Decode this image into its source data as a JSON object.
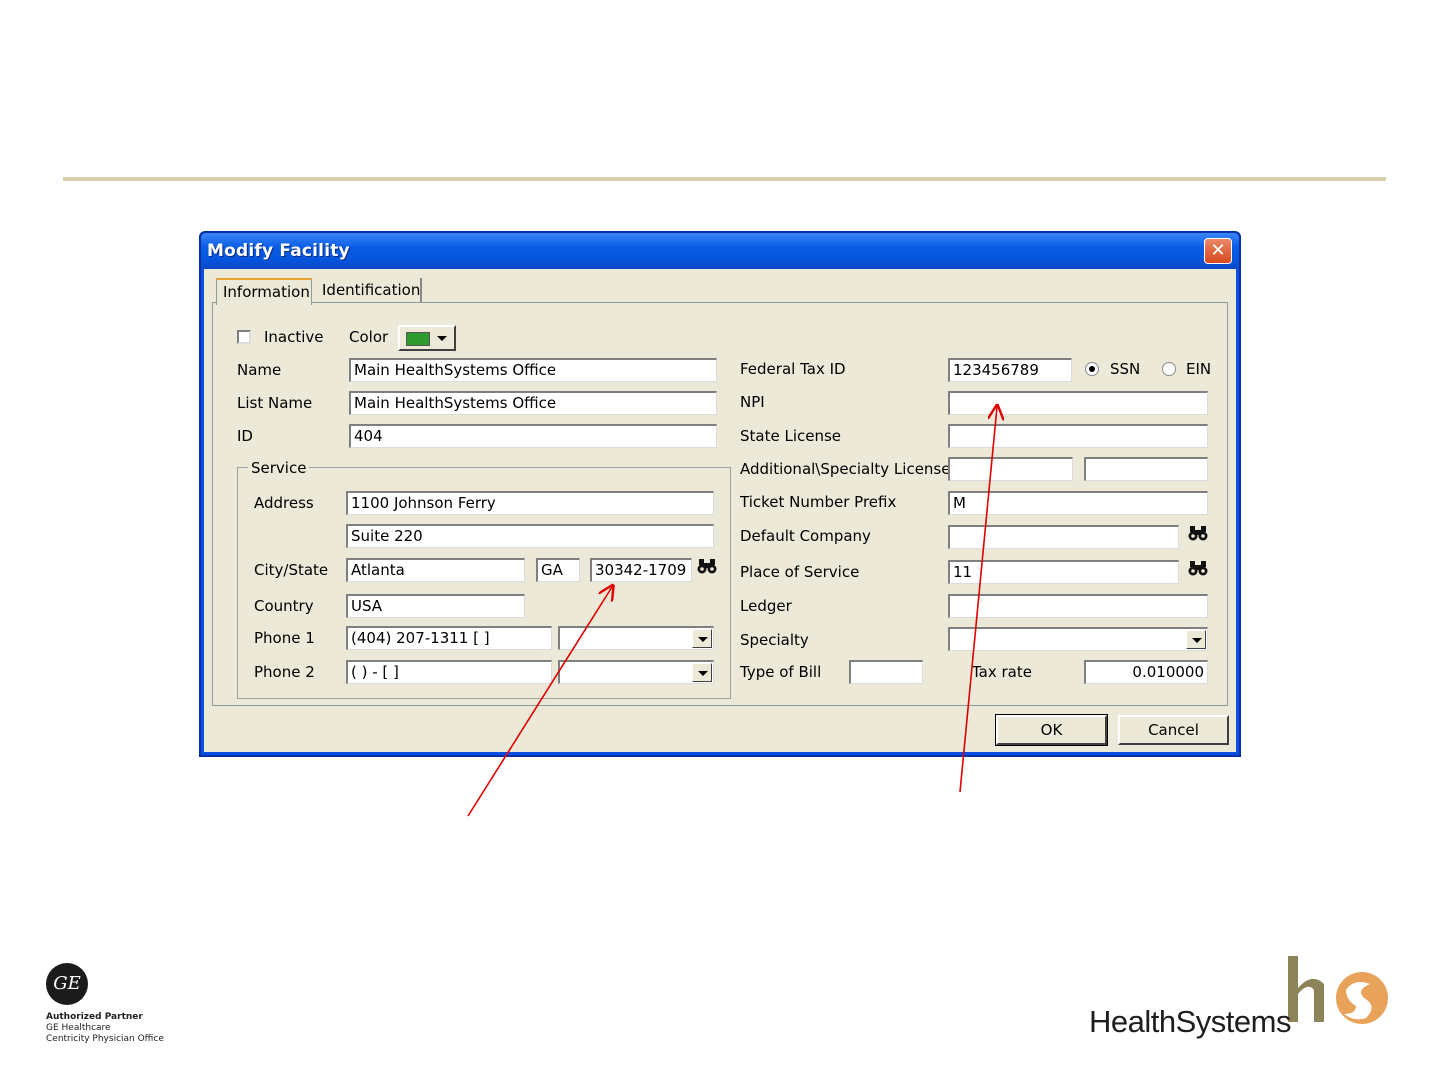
{
  "dialog": {
    "title": "Modify Facility",
    "close_symbol": "✕",
    "tabs": [
      "Information",
      "Identification"
    ],
    "inactive_label": "Inactive",
    "inactive_checked": false,
    "color_label": "Color",
    "color_value": "#2f9b2f"
  },
  "left": {
    "name_label": "Name",
    "name_value": "Main HealthSystems Office",
    "listname_label": "List Name",
    "listname_value": "Main HealthSystems Office",
    "id_label": "ID",
    "id_value": "404",
    "service_group": "Service",
    "address_label": "Address",
    "address1": "1100 Johnson Ferry",
    "address2": "Suite 220",
    "city_label": "City/State",
    "city": "Atlanta",
    "state": "GA",
    "zip": "30342-1709",
    "country_label": "Country",
    "country": "USA",
    "phone1_label": "Phone 1",
    "phone1": "(404) 207-1311 [     ]",
    "phone2_label": "Phone 2",
    "phone2": "(  )    -     [     ]"
  },
  "right": {
    "fedtax_label": "Federal Tax ID",
    "fedtax_value": "123456789",
    "ssn_label": "SSN",
    "ein_label": "EIN",
    "ssn_selected": true,
    "npi_label": "NPI",
    "npi_value": "",
    "state_license_label": "State License",
    "additional_label": "Additional\\Specialty License",
    "ticket_label": "Ticket Number Prefix",
    "ticket_value": "M",
    "default_company_label": "Default Company",
    "pos_label": "Place of Service",
    "pos_value": "11",
    "ledger_label": "Ledger",
    "specialty_label": "Specialty",
    "typebill_label": "Type of Bill",
    "taxrate_label": "Tax rate",
    "taxrate_value": "0.010000"
  },
  "buttons": {
    "ok": "OK",
    "cancel": "Cancel"
  },
  "icons": {
    "lookup": "binoculars-icon"
  },
  "annotation_color": "#e00000",
  "footer": {
    "ge_logo_text": "GE",
    "ge_lines": [
      "Authorized Partner",
      "GE Healthcare",
      "Centricity Physician Office"
    ],
    "hs_brand": "HealthSystems"
  }
}
